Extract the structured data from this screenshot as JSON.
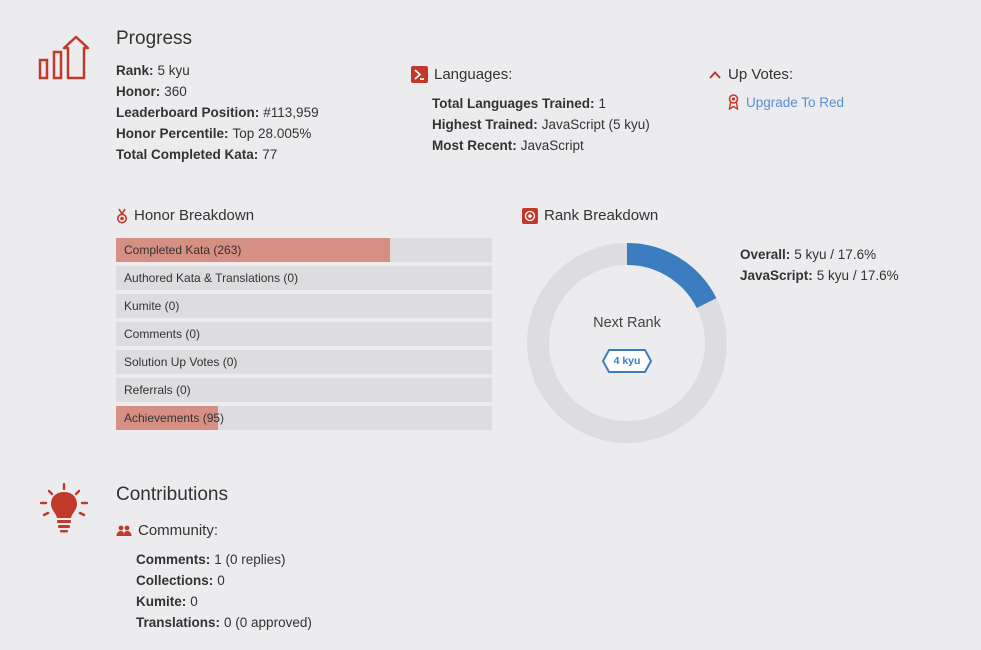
{
  "progress": {
    "title": "Progress",
    "stats": [
      {
        "label": "Rank:",
        "value": "5 kyu"
      },
      {
        "label": "Honor:",
        "value": "360"
      },
      {
        "label": "Leaderboard Position:",
        "value": "#113,959"
      },
      {
        "label": "Honor Percentile:",
        "value": "Top 28.005%"
      },
      {
        "label": "Total Completed Kata:",
        "value": "77"
      }
    ]
  },
  "languages": {
    "title": "Languages:",
    "stats": [
      {
        "label": "Total Languages Trained:",
        "value": "1"
      },
      {
        "label": "Highest Trained:",
        "value": "JavaScript (5 kyu)"
      },
      {
        "label": "Most Recent:",
        "value": "JavaScript"
      }
    ]
  },
  "upvotes": {
    "title": "Up Votes:",
    "link": "Upgrade To Red"
  },
  "honor_breakdown": {
    "title": "Honor Breakdown",
    "rows": [
      {
        "label": "Completed Kata (263)",
        "fill": 0.729
      },
      {
        "label": "Authored Kata & Translations (0)",
        "fill": 0
      },
      {
        "label": "Kumite (0)",
        "fill": 0
      },
      {
        "label": "Comments (0)",
        "fill": 0
      },
      {
        "label": "Solution Up Votes (0)",
        "fill": 0
      },
      {
        "label": "Referrals (0)",
        "fill": 0
      },
      {
        "label": "Achievements (95)",
        "fill": 0.271
      }
    ]
  },
  "rank_breakdown": {
    "title": "Rank Breakdown",
    "center_label": "Next Rank",
    "next_rank": "4 kyu",
    "progress": 0.176,
    "stats": [
      {
        "label": "Overall:",
        "value": "5 kyu / 17.6%"
      },
      {
        "label": "JavaScript:",
        "value": "5 kyu / 17.6%"
      }
    ]
  },
  "contributions": {
    "title": "Contributions",
    "community_title": "Community:",
    "stats": [
      {
        "label": "Comments:",
        "value": "1 (0 replies)"
      },
      {
        "label": "Collections:",
        "value": "0"
      },
      {
        "label": "Kumite:",
        "value": "0"
      },
      {
        "label": "Translations:",
        "value": "0 (0 approved)"
      }
    ]
  },
  "colors": {
    "accent": "#c0392b",
    "bar_fill": "#d68f83",
    "bar_bg": "#dddde0",
    "donut_fill": "#3c7dc0",
    "donut_bg": "#dddde0",
    "link": "#5b8fd0"
  },
  "icons": {
    "progress": "bar-chart-up-arrow-icon",
    "languages": "terminal-icon",
    "upvotes": "chevron-up-icon",
    "upgrade": "badge-icon",
    "honor": "medal-icon",
    "rank": "target-icon",
    "contributions": "lightbulb-icon",
    "community": "people-icon"
  }
}
